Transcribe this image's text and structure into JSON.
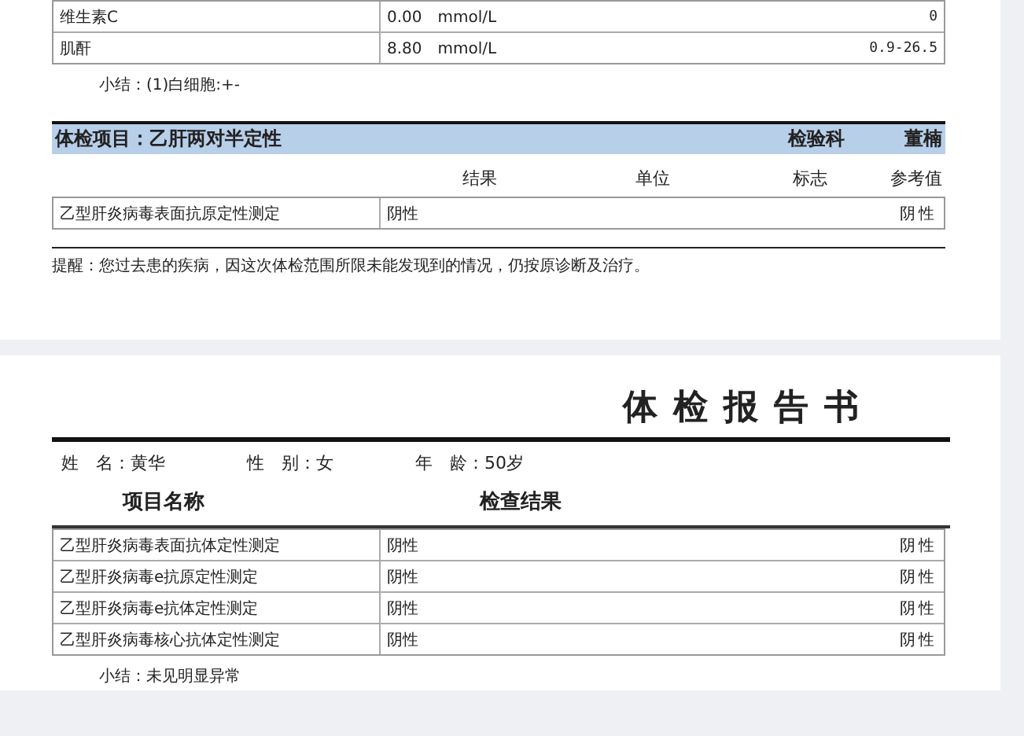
{
  "page1": {
    "results": [
      {
        "name": "维生素C",
        "value": "0.00",
        "unit": "mmol/L",
        "reference": "0"
      },
      {
        "name": "肌酐",
        "value": "8.80",
        "unit": "mmol/L",
        "reference": "0.9-26.5"
      }
    ],
    "summary": "小结：(1)白细胞:+-",
    "section": {
      "title": "体检项目：乙肝两对半定性",
      "department": "检验科",
      "doctor": "董楠",
      "columns": [
        "结果",
        "单位",
        "标志",
        "参考值"
      ],
      "rows": [
        {
          "name": "乙型肝炎病毒表面抗原定性测定",
          "result": "阴性",
          "reference": "阴性"
        }
      ]
    },
    "reminder": "提醒：您过去患的疾病，因这次体检范围所限未能发现到的情况，仍按原诊断及治疗。"
  },
  "page2": {
    "title": "体检报告书",
    "patient": [
      "姓　名：黄华",
      "性　别：女",
      "年　龄：50岁"
    ],
    "columns": [
      "项目名称",
      "检查结果"
    ],
    "rows": [
      {
        "name": "乙型肝炎病毒表面抗体定性测定",
        "result": "阴性",
        "reference": "阴性"
      },
      {
        "name": "乙型肝炎病毒e抗原定性测定",
        "result": "阴性",
        "reference": "阴性"
      },
      {
        "name": "乙型肝炎病毒e抗体定性测定",
        "result": "阴性",
        "reference": "阴性"
      },
      {
        "name": "乙型肝炎病毒核心抗体定性测定",
        "result": "阴性",
        "reference": "阴性"
      }
    ],
    "summary": "小结：未见明显异常"
  }
}
